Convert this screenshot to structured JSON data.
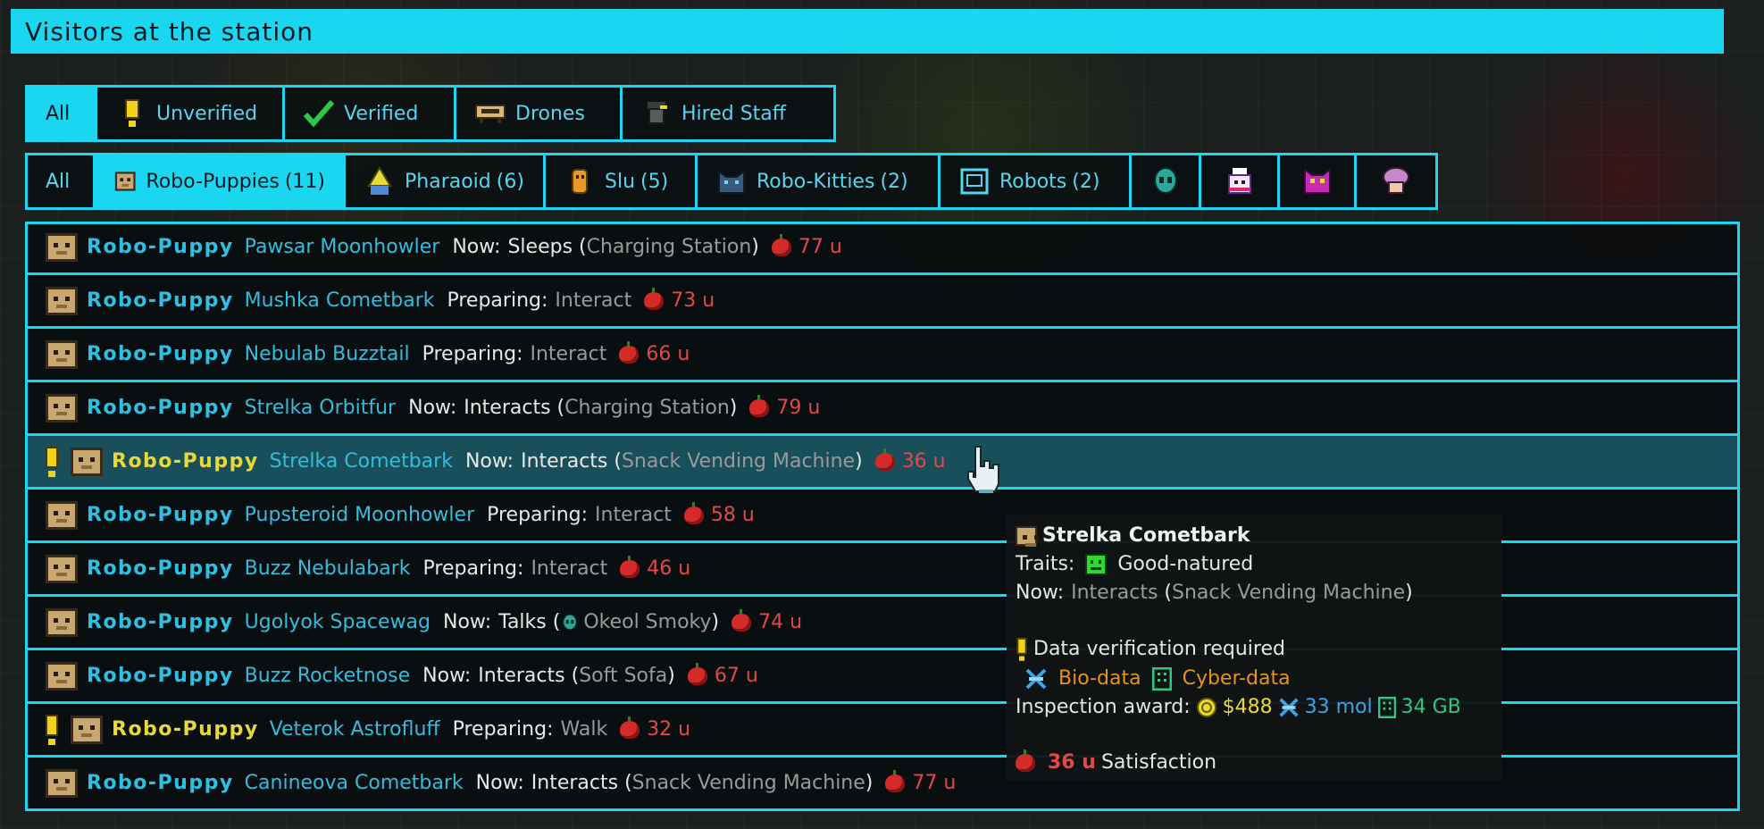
{
  "window": {
    "title": "Visitors at the station"
  },
  "status_tabs": [
    {
      "label": "All",
      "icon": "",
      "active": true
    },
    {
      "label": "Unverified",
      "icon": "exclamation-icon",
      "active": false
    },
    {
      "label": "Verified",
      "icon": "checkmark-icon",
      "active": false
    },
    {
      "label": "Drones",
      "icon": "drone-icon",
      "active": false
    },
    {
      "label": "Hired Staff",
      "icon": "hired-staff-icon",
      "active": false
    }
  ],
  "species_tabs": [
    {
      "label": "All",
      "count": "",
      "icon": "",
      "active": false
    },
    {
      "label": "Robo-Puppies",
      "count": "(11)",
      "icon": "robo-puppy-icon",
      "active": true
    },
    {
      "label": "Pharaoid",
      "count": "(6)",
      "icon": "pharaoid-icon",
      "active": false
    },
    {
      "label": "Slu",
      "count": "(5)",
      "icon": "slu-icon",
      "active": false
    },
    {
      "label": "Robo-Kitties",
      "count": "(2)",
      "icon": "robo-kitty-icon",
      "active": false
    },
    {
      "label": "Robots",
      "count": "(2)",
      "icon": "robot-icon",
      "active": false
    },
    {
      "label": "",
      "count": "",
      "icon": "green-alien-icon",
      "active": false
    },
    {
      "label": "",
      "count": "",
      "icon": "ghost-chef-icon",
      "active": false
    },
    {
      "label": "",
      "count": "",
      "icon": "pink-demon-icon",
      "active": false
    },
    {
      "label": "",
      "count": "",
      "icon": "pink-mushroom-icon",
      "active": false
    }
  ],
  "visitors": [
    {
      "unverified": false,
      "species": "Robo-Puppy",
      "name": "Pawsar Moonhowler",
      "action_prefix": "Now:",
      "action": "Sleeps",
      "paren_open": " (",
      "object_icon": "",
      "object": "Charging Station",
      "paren_close": ")",
      "satisfaction": "77 u",
      "highlight": false
    },
    {
      "unverified": false,
      "species": "Robo-Puppy",
      "name": "Mushka Cometbark",
      "action_prefix": "Preparing:",
      "action": "Interact",
      "paren_open": "",
      "object_icon": "",
      "object": "",
      "paren_close": "",
      "satisfaction": "73 u",
      "highlight": false
    },
    {
      "unverified": false,
      "species": "Robo-Puppy",
      "name": "Nebulab Buzztail",
      "action_prefix": "Preparing:",
      "action": "Interact",
      "paren_open": "",
      "object_icon": "",
      "object": "",
      "paren_close": "",
      "satisfaction": "66 u",
      "highlight": false
    },
    {
      "unverified": false,
      "species": "Robo-Puppy",
      "name": "Strelka Orbitfur",
      "action_prefix": "Now:",
      "action": "Interacts",
      "paren_open": " (",
      "object_icon": "",
      "object": "Charging Station",
      "paren_close": ")",
      "satisfaction": "79 u",
      "highlight": false
    },
    {
      "unverified": true,
      "species": "Robo-Puppy",
      "name": "Strelka Cometbark",
      "action_prefix": "Now:",
      "action": "Interacts",
      "paren_open": " (",
      "object_icon": "",
      "object": "Snack Vending Machine",
      "paren_close": ")",
      "satisfaction": "36 u",
      "highlight": true
    },
    {
      "unverified": false,
      "species": "Robo-Puppy",
      "name": "Pupsteroid Moonhowler",
      "action_prefix": "Preparing:",
      "action": "Interact",
      "paren_open": "",
      "object_icon": "",
      "object": "",
      "paren_close": "",
      "satisfaction": "58 u",
      "highlight": false
    },
    {
      "unverified": false,
      "species": "Robo-Puppy",
      "name": "Buzz Nebulabark",
      "action_prefix": "Preparing:",
      "action": "Interact",
      "paren_open": "",
      "object_icon": "",
      "object": "",
      "paren_close": "",
      "satisfaction": "46 u",
      "highlight": false
    },
    {
      "unverified": false,
      "species": "Robo-Puppy",
      "name": "Ugolyok Spacewag",
      "action_prefix": "Now:",
      "action": "Talks",
      "paren_open": " (",
      "object_icon": "green-alien-icon",
      "object": "Okeol Smoky",
      "paren_close": ")",
      "satisfaction": "74 u",
      "highlight": false
    },
    {
      "unverified": false,
      "species": "Robo-Puppy",
      "name": "Buzz Rocketnose",
      "action_prefix": "Now:",
      "action": "Interacts",
      "paren_open": " (",
      "object_icon": "",
      "object": "Soft Sofa",
      "paren_close": ")",
      "satisfaction": "67 u",
      "highlight": false
    },
    {
      "unverified": true,
      "species": "Robo-Puppy",
      "name": "Veterok Astrofluff",
      "action_prefix": "Preparing:",
      "action": "Walk",
      "paren_open": "",
      "object_icon": "",
      "object": "",
      "paren_close": "",
      "satisfaction": "32 u",
      "highlight": false
    },
    {
      "unverified": false,
      "species": "Robo-Puppy",
      "name": "Canineova Cometbark",
      "action_prefix": "Now:",
      "action": "Interacts",
      "paren_open": " (",
      "object_icon": "",
      "object": "Snack Vending Machine",
      "paren_close": ")",
      "satisfaction": "77 u",
      "highlight": false
    }
  ],
  "tooltip": {
    "name": "Strelka Cometbark",
    "traits_label": "Traits:",
    "trait": "Good-natured",
    "now_label": "Now:",
    "now_action": "Interacts",
    "now_object_open": " (",
    "now_object": "Snack Vending Machine",
    "now_object_close": ")",
    "verification": "Data verification required",
    "data_1": "Bio-data",
    "data_2": "Cyber-data",
    "award_label": "Inspection award:",
    "award_money": "$488",
    "award_bio": "33 mol",
    "award_cyber": "34 GB",
    "satisfaction_value": "36 u",
    "satisfaction_label": "Satisfaction"
  },
  "colors": {
    "accent": "#1ad6ef",
    "species_name": "#2ec0e2",
    "unverified_species": "#e8d838",
    "satisfaction": "#e24848"
  }
}
